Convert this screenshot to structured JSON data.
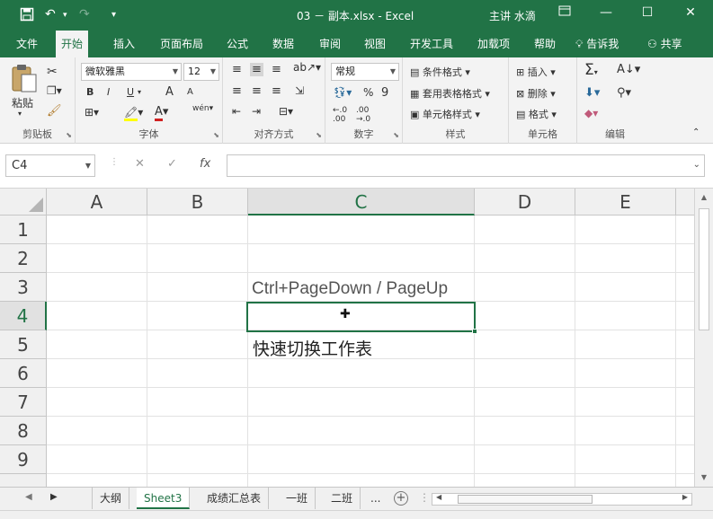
{
  "window": {
    "title": "03 － 副本.xlsx  -  Excel",
    "user": "主讲 水滴",
    "colors": {
      "brand": "#217346",
      "ribbon_bg": "#f3f3f3",
      "grid_line": "#e2e2e2"
    }
  },
  "ribbon_tabs": [
    "文件",
    "开始",
    "插入",
    "页面布局",
    "公式",
    "数据",
    "审阅",
    "视图",
    "开发工具",
    "加载项",
    "帮助"
  ],
  "tell_me": "告诉我",
  "share": "共享",
  "ribbon": {
    "clipboard": {
      "paste": "粘贴",
      "label": "剪贴板"
    },
    "font": {
      "name": "微软雅黑",
      "size": "12",
      "label": "字体",
      "bold": "B",
      "italic": "I",
      "underline": "U",
      "grow": "A",
      "shrink": "A",
      "phonetic": "wén"
    },
    "alignment": {
      "label": "对齐方式"
    },
    "number": {
      "format": "常规",
      "label": "数字",
      "percent": "%",
      "comma": "9"
    },
    "styles": {
      "conditional": "条件格式",
      "table": "套用表格格式",
      "cell": "单元格样式",
      "label": "样式"
    },
    "cells": {
      "insert": "插入",
      "delete": "删除",
      "format": "格式",
      "label": "单元格"
    },
    "editing": {
      "sum": "Σ",
      "label": "编辑"
    }
  },
  "formula_bar": {
    "name_box": "C4",
    "cancel": "✕",
    "enter": "✓",
    "fx": "fx",
    "value": ""
  },
  "grid": {
    "columns": [
      "A",
      "B",
      "C",
      "D",
      "E"
    ],
    "rows": [
      "1",
      "2",
      "3",
      "4",
      "5",
      "6",
      "7",
      "8",
      "9"
    ],
    "selected_column": "C",
    "selected_row": "4",
    "cells": {
      "C3": "Ctrl+PageDown / PageUp",
      "C5": "快速切换工作表"
    }
  },
  "sheets": {
    "tabs": [
      "大纲",
      "Sheet3",
      "成绩汇总表",
      "一班",
      "二班"
    ],
    "active": "Sheet3",
    "more": "..."
  }
}
